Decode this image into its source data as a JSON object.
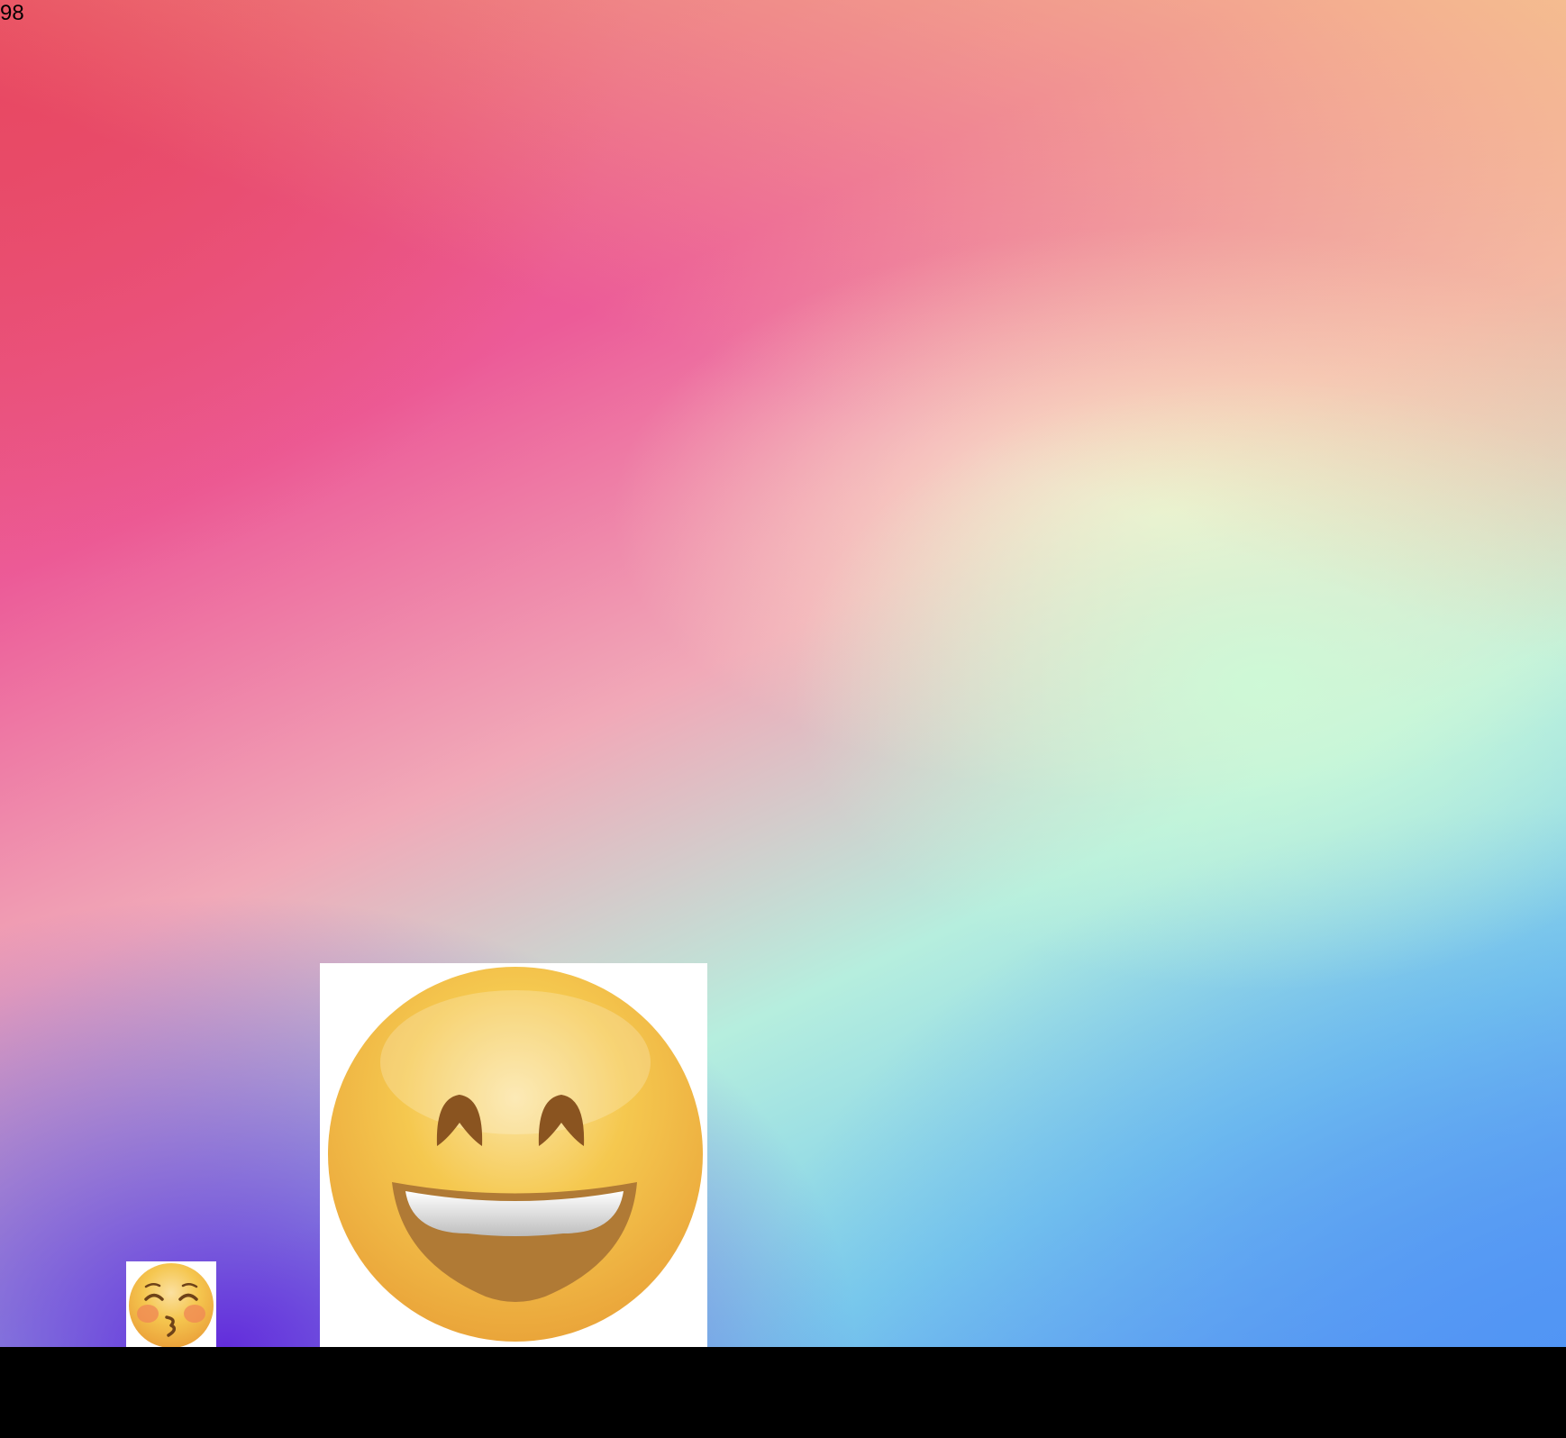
{
  "counter": {
    "value": "98"
  },
  "tiles": [
    {
      "icon": "grinning-face-with-smiling-eyes-icon"
    },
    {
      "icon": "kissing-face-with-smiling-eyes-icon"
    }
  ],
  "colors": {
    "background_top_left": "#e8506e",
    "background_top_right": "#f6c88c",
    "background_center": "#fcf2cd",
    "background_mint": "#cdfad7",
    "background_bottom_left": "#5f23dc",
    "background_bottom_right": "#5096f5",
    "tile_background": "#ffffff",
    "bottom_bar": "#000000",
    "emoji_face": "#f5c64f",
    "emoji_mouth": "#b07a35",
    "emoji_eye": "#8a5420",
    "emoji_blush": "#f08a55"
  }
}
